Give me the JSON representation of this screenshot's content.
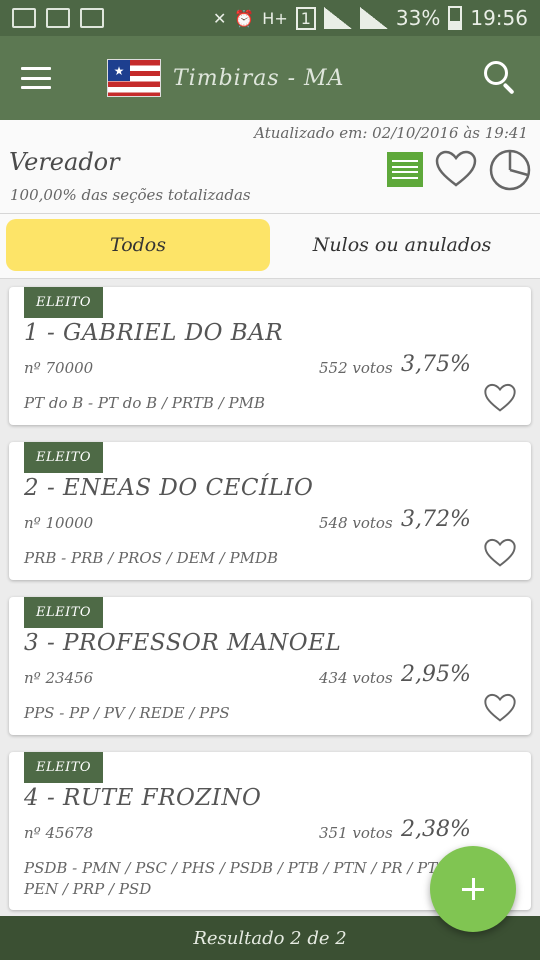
{
  "status_bar": {
    "time": "19:56",
    "battery": "33%",
    "icons": [
      "image-icon",
      "voicemail-icon",
      "voicemail-icon",
      "mute-icon",
      "alarm-icon",
      "signal-icon",
      "battery-icon"
    ]
  },
  "app_bar": {
    "title": "Timbiras - MA",
    "menu_icon": "hamburger-menu-icon",
    "flag_icon": "maranhao-flag-icon",
    "search_icon": "search-icon"
  },
  "info": {
    "updated": "Atualizado em: 02/10/2016 às 19:41",
    "office": "Vereador",
    "sections": "100,00% das seções totalizadas",
    "accent": "#5ea83a"
  },
  "tabs": [
    {
      "label": "Todos",
      "active": true
    },
    {
      "label": "Nulos ou anulados",
      "active": false
    }
  ],
  "candidates": [
    {
      "badge": "ELEITO",
      "name": "1 - GABRIEL DO BAR",
      "number": "nº 70000",
      "votes": "552 votos",
      "percent": "3,75%",
      "parties": "PT do B - PT do B / PRTB / PMB"
    },
    {
      "badge": "ELEITO",
      "name": "2 - ENEAS DO CECÍLIO",
      "number": "nº 10000",
      "votes": "548 votos",
      "percent": "3,72%",
      "parties": "PRB - PRB / PROS / DEM / PMDB"
    },
    {
      "badge": "ELEITO",
      "name": "3 - PROFESSOR MANOEL",
      "number": "nº 23456",
      "votes": "434 votos",
      "percent": "2,95%",
      "parties": "PPS - PP / PV / REDE / PPS"
    },
    {
      "badge": "ELEITO",
      "name": "4 - RUTE FROZINO",
      "number": "nº 45678",
      "votes": "351 votos",
      "percent": "2,38%",
      "parties": "PSDB - PMN / PSC / PHS / PSDB / PTB / PTN / PR / PT PEN / PRP / PSD"
    }
  ],
  "footer": {
    "result": "Resultado 2 de 2"
  },
  "colors": {
    "app_bar": "#5c7852",
    "badge": "#4e6a46",
    "tab_active": "#fde468",
    "fab": "#80c552"
  }
}
